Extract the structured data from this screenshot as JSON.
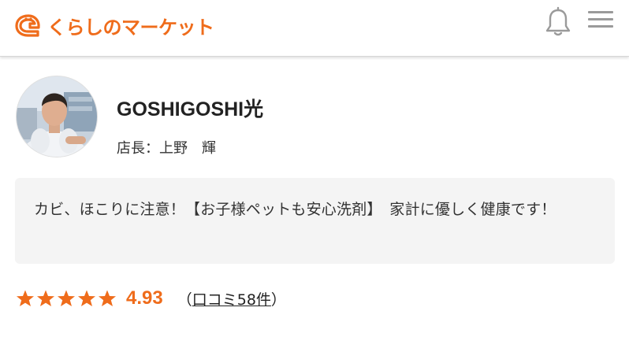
{
  "brand": {
    "logo_text": "くらしのマーケット",
    "accent_color": "#ef6c1b"
  },
  "header": {
    "icons": [
      "bell-icon",
      "hamburger-menu-icon"
    ],
    "icon_color": "#9a9a9a"
  },
  "shop": {
    "name": "GOSHIGOSHI光",
    "manager_label": "店長：",
    "manager_name": "上野　輝",
    "description": "カビ、ほこりに注意！【お子様ペットも安心洗剤】　家計に優しく健康です！"
  },
  "rating": {
    "stars": 5,
    "score": "4.93",
    "reviews_open": "（",
    "reviews_link": "口コミ58件",
    "reviews_close": "）",
    "star_color": "#ef6c1b"
  }
}
